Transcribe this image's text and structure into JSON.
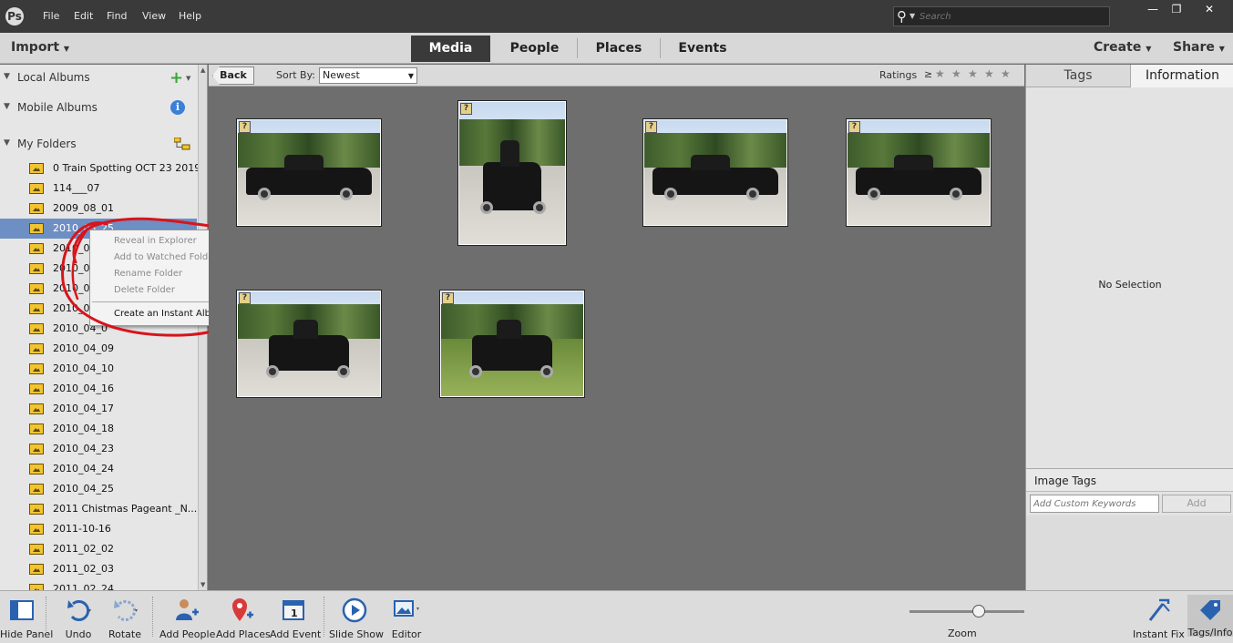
{
  "menu": {
    "app_logo": "Ps",
    "items": [
      "File",
      "Edit",
      "Find",
      "View",
      "Help"
    ],
    "search_placeholder": "Search"
  },
  "window_controls": {
    "minimize": "—",
    "restore": "❐",
    "close": "✕"
  },
  "workspace": {
    "import_label": "Import",
    "tabs": [
      {
        "label": "Media",
        "active": true
      },
      {
        "label": "People",
        "active": false
      },
      {
        "label": "Places",
        "active": false
      },
      {
        "label": "Events",
        "active": false
      }
    ],
    "create_label": "Create",
    "share_label": "Share"
  },
  "left_panel": {
    "local_albums": "Local Albums",
    "mobile_albums": "Mobile Albums",
    "my_folders": "My Folders",
    "folders": [
      {
        "label": "0 Train Spotting OCT 23 2019",
        "selected": false
      },
      {
        "label": "114___07",
        "selected": false
      },
      {
        "label": "2009_08_01",
        "selected": false
      },
      {
        "label": "2010_03_25",
        "selected": true
      },
      {
        "label": "2010_03",
        "selected": false
      },
      {
        "label": "2010_03",
        "selected": false
      },
      {
        "label": "2010_03",
        "selected": false
      },
      {
        "label": "2010_0",
        "selected": false
      },
      {
        "label": "2010_04_0",
        "selected": false
      },
      {
        "label": "2010_04_09",
        "selected": false
      },
      {
        "label": "2010_04_10",
        "selected": false
      },
      {
        "label": "2010_04_16",
        "selected": false
      },
      {
        "label": "2010_04_17",
        "selected": false
      },
      {
        "label": "2010_04_18",
        "selected": false
      },
      {
        "label": "2010_04_23",
        "selected": false
      },
      {
        "label": "2010_04_24",
        "selected": false
      },
      {
        "label": "2010_04_25",
        "selected": false
      },
      {
        "label": "2011 Chistmas Pageant _N...",
        "selected": false
      },
      {
        "label": "2011-10-16",
        "selected": false
      },
      {
        "label": "2011_02_02",
        "selected": false
      },
      {
        "label": "2011_02_03",
        "selected": false
      },
      {
        "label": "2011_02_24",
        "selected": false
      }
    ]
  },
  "context_menu": {
    "items": [
      {
        "label": "Reveal in Explorer",
        "enabled": false
      },
      {
        "label": "Add to Watched Folders",
        "enabled": false
      },
      {
        "label": "Rename Folder",
        "enabled": false
      },
      {
        "label": "Delete Folder",
        "enabled": false
      },
      {
        "label": "Create an Instant Album",
        "enabled": true
      }
    ],
    "annotation_color": "#d8141c"
  },
  "toolbar": {
    "back_label": "Back",
    "sort_label": "Sort By:",
    "sort_value": "Newest",
    "ratings_label": "Ratings",
    "ratings_operator": "≥",
    "stars": [
      "★",
      "★",
      "★",
      "★",
      "★"
    ]
  },
  "media": {
    "badge": "?",
    "thumbnails": [
      {
        "kind": "truck-side",
        "ground": "pavement"
      },
      {
        "kind": "truck-front",
        "ground": "pavement"
      },
      {
        "kind": "truck-side",
        "ground": "pavement"
      },
      {
        "kind": "truck-side",
        "ground": "pavement"
      },
      {
        "kind": "truck-rear",
        "ground": "pavement"
      },
      {
        "kind": "truck-front",
        "ground": "grass"
      }
    ]
  },
  "right_panel": {
    "tabs": [
      {
        "label": "Tags",
        "active": false
      },
      {
        "label": "Information",
        "active": true
      }
    ],
    "no_selection": "No Selection",
    "image_tags_label": "Image Tags",
    "keyword_placeholder": "Add Custom Keywords",
    "add_label": "Add"
  },
  "bottom_bar": {
    "buttons": [
      {
        "label": "Hide Panel",
        "icon": "hide-panel-icon"
      },
      {
        "label": "Undo",
        "icon": "undo-icon"
      },
      {
        "label": "Rotate",
        "icon": "rotate-icon"
      },
      {
        "label": "Add People",
        "icon": "add-people-icon"
      },
      {
        "label": "Add Places",
        "icon": "add-places-icon"
      },
      {
        "label": "Add Event",
        "icon": "add-event-icon"
      },
      {
        "label": "Slide Show",
        "icon": "slide-show-icon"
      },
      {
        "label": "Editor",
        "icon": "editor-icon"
      },
      {
        "label": "Instant Fix",
        "icon": "instant-fix-icon"
      },
      {
        "label": "Tags/Info",
        "icon": "tags-info-icon"
      }
    ],
    "event_icon_digit": "1",
    "zoom_label": "Zoom",
    "zoom_level": 0.6
  },
  "colors": {
    "selection": "#6d8fc4",
    "active_tab": "#3a3a3a",
    "grid_background": "#6e6e6e",
    "accent_blue": "#3b7fd6"
  }
}
